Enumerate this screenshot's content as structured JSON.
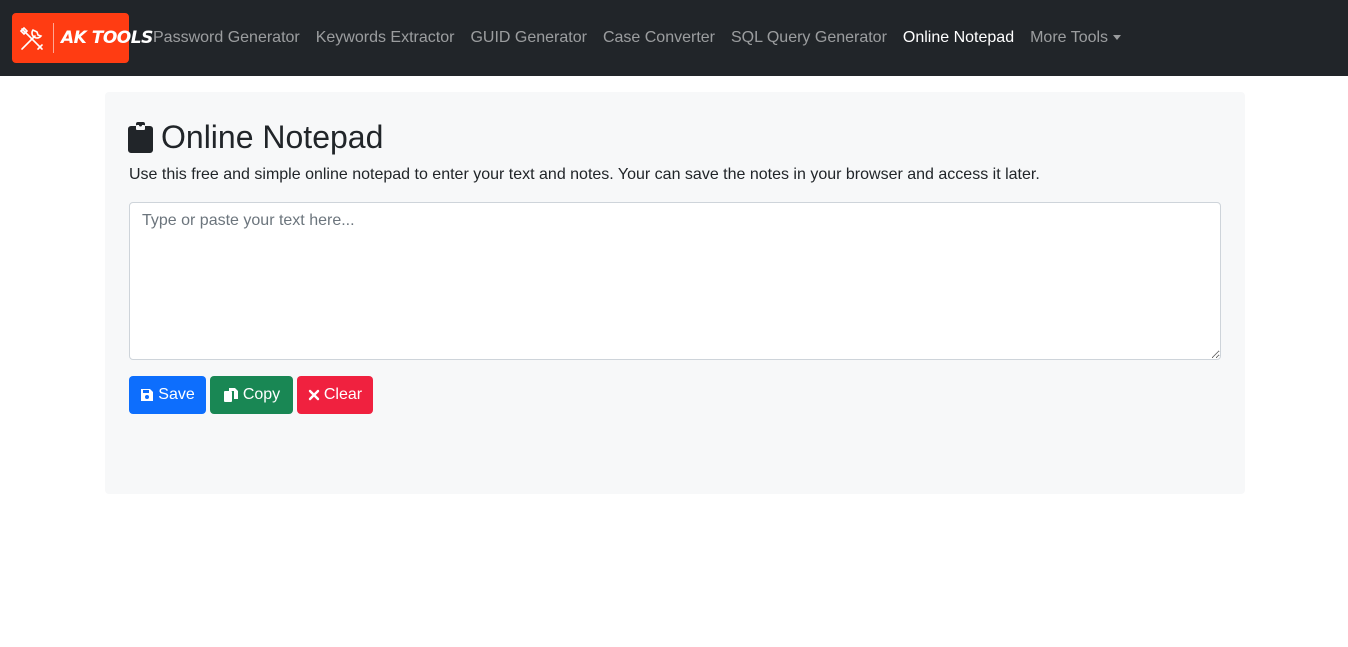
{
  "brand": {
    "logo_text": "AK TOOLS",
    "logo_icon": "tools-icon",
    "color": "#ff3c12"
  },
  "nav": {
    "items": [
      {
        "label": "Password Generator",
        "active": false
      },
      {
        "label": "Keywords Extractor",
        "active": false
      },
      {
        "label": "GUID Generator",
        "active": false
      },
      {
        "label": "Case Converter",
        "active": false
      },
      {
        "label": "SQL Query Generator",
        "active": false
      },
      {
        "label": "Online Notepad",
        "active": true
      },
      {
        "label": "More Tools",
        "active": false,
        "dropdown": true
      }
    ]
  },
  "main": {
    "title": "Online Notepad",
    "title_icon": "clipboard-icon",
    "description": "Use this free and simple online notepad to enter your text and notes. Your can save the notes in your browser and access it later.",
    "notepad": {
      "value": "",
      "placeholder": "Type or paste your text here..."
    },
    "buttons": {
      "save": {
        "label": "Save",
        "icon": "floppy-disk-icon",
        "color": "#0d6efd"
      },
      "copy": {
        "label": "Copy",
        "icon": "copy-icon",
        "color": "#198754"
      },
      "clear": {
        "label": "Clear",
        "icon": "x-icon",
        "color": "#f0213f"
      }
    }
  }
}
